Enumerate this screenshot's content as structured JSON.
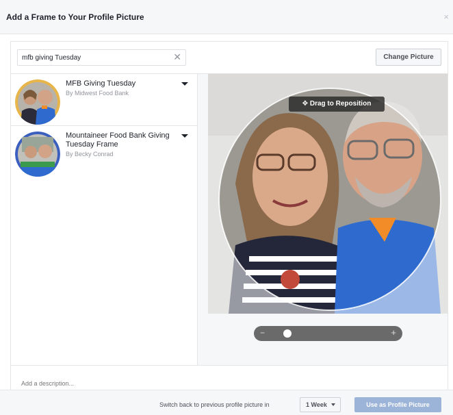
{
  "dialog": {
    "title": "Add a Frame to Your Profile Picture",
    "close_glyph": "×"
  },
  "search": {
    "value": "mfb giving Tuesday",
    "clear_glyph": "✕"
  },
  "change_picture_label": "Change Picture",
  "frames": [
    {
      "title": "MFB Giving Tuesday",
      "author": "By Midwest Food Bank"
    },
    {
      "title": "Mountaineer Food Bank Giving Tuesday Frame",
      "author": "By Becky Conrad"
    }
  ],
  "preview": {
    "drag_label": "Drag to Reposition",
    "drag_icon": "move-arrows-icon",
    "zoom_minus": "−",
    "zoom_plus": "+",
    "zoom_level": 0.12
  },
  "description": {
    "placeholder": "Add a description..."
  },
  "footer": {
    "switch_label": "Switch back to previous profile picture in",
    "duration_value": "1 Week",
    "use_button_label": "Use as Profile Picture"
  },
  "colors": {
    "header_bg": "#f6f7f9",
    "accent_disabled": "#9cb4d8",
    "frame_ring_gold": "#e8b54a",
    "frame_ring_blue": "#3b5fbf",
    "shirt_blue": "#2f6bcf",
    "shirt_orange": "#f28c28"
  }
}
